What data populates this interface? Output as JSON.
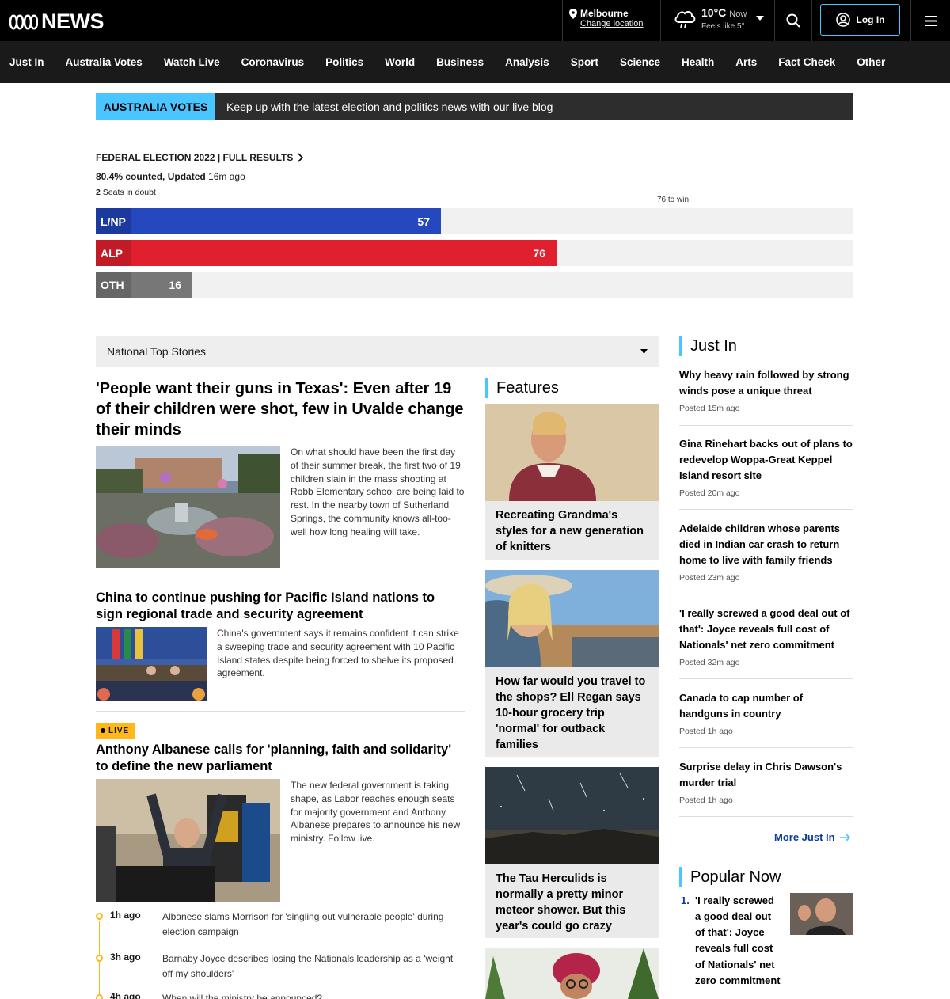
{
  "header": {
    "logo_text": "NEWS",
    "location": {
      "city": "Melbourne",
      "change": "Change location"
    },
    "weather": {
      "temp": "10°C",
      "now": "Now",
      "feels": "Feels like 5°"
    },
    "login_label": "Log In"
  },
  "nav": [
    "Just In",
    "Australia Votes",
    "Watch Live",
    "Coronavirus",
    "Politics",
    "World",
    "Business",
    "Analysis",
    "Sport",
    "Science",
    "Health",
    "Arts",
    "Fact Check",
    "Other"
  ],
  "banner": {
    "tag": "AUSTRALIA VOTES",
    "text": "Keep up with the latest election and politics news with our live blog"
  },
  "election": {
    "title": "FEDERAL ELECTION 2022 | FULL RESULTS",
    "counted_bold": "80.4% counted,",
    "updated_bold": "Updated",
    "updated_time": "16m ago",
    "doubt_num": "2",
    "doubt_text": "Seats in doubt",
    "win_label": "76 to win",
    "win_target": 76,
    "max_seats": 125,
    "parties": [
      {
        "name": "L/NP",
        "seats": 57,
        "color": "#2548bf",
        "label_bg": "#1c3a9e"
      },
      {
        "name": "ALP",
        "seats": 76,
        "color": "#e0202e",
        "label_bg": "#c21a26"
      },
      {
        "name": "OTH",
        "seats": 16,
        "color": "#777777",
        "label_bg": "#666666"
      }
    ]
  },
  "top_stories": {
    "selector": "National Top Stories",
    "lead": {
      "headline": "'People want their guns in Texas': Even after 19 of their children were shot, few in Uvalde change their minds",
      "blurb": "On what should have been the first day of their summer break, the first two of 19 children slain in the mass shooting at Robb Elementary school are being laid to rest. In the nearby town of Sutherland Springs, the community knows all-too-well how long healing will take."
    },
    "second": {
      "headline": "China to continue pushing for Pacific Island nations to sign regional trade and security agreement",
      "blurb": "China's government says it remains confident it can strike a sweeping trade and security agreement with 10 Pacific Island states despite being forced to shelve its proposed agreement."
    },
    "live": {
      "badge": "LIVE",
      "headline": "Anthony Albanese calls for 'planning, faith and solidarity' to define the new parliament",
      "blurb": "The new federal government is taking shape, as Labor reaches enough seats for majority government and Anthony Albanese prepares to announce his new ministry. Follow live.",
      "updates": [
        {
          "time": "1h ago",
          "text": "Albanese slams Morrison for 'singling out vulnerable people' during election campaign"
        },
        {
          "time": "3h ago",
          "text": "Barnaby Joyce describes losing the Nationals leadership as a 'weight off my shoulders'"
        },
        {
          "time": "4h ago",
          "text": "When will the ministry be announced?"
        }
      ]
    }
  },
  "features": {
    "heading": "Features",
    "items": [
      {
        "title": "Recreating Grandma's styles for a new generation of knitters"
      },
      {
        "title": "How far would you travel to the shops? Ell Regan says 10-hour grocery trip 'normal' for outback families"
      },
      {
        "title": "The Tau Herculids is normally a pretty minor meteor shower. But this year's could go crazy"
      }
    ]
  },
  "just_in": {
    "heading": "Just In",
    "items": [
      {
        "title": "Why heavy rain followed by strong winds pose a unique threat",
        "time": "Posted 15m ago"
      },
      {
        "title": "Gina Rinehart backs out of plans to redevelop Woppa-Great Keppel Island resort site",
        "time": "Posted 20m ago"
      },
      {
        "title": "Adelaide children whose parents died in Indian car crash to return home to live with family friends",
        "time": "Posted 23m ago"
      },
      {
        "title": "'I really screwed a good deal out of that': Joyce reveals full cost of Nationals' net zero commitment",
        "time": "Posted 32m ago"
      },
      {
        "title": "Canada to cap number of handguns in country",
        "time": "Posted 1h ago"
      },
      {
        "title": "Surprise delay in Chris Dawson's murder trial",
        "time": "Posted 1h ago"
      }
    ],
    "more": "More Just In"
  },
  "popular": {
    "heading": "Popular Now",
    "items": [
      {
        "num": "1.",
        "title": "'I really screwed a good deal out of that': Joyce reveals full cost of Nationals' net zero commitment"
      }
    ]
  },
  "colors": {
    "accent": "#4ac5ff",
    "live": "#ffb71b",
    "link": "#0a3ba0"
  }
}
